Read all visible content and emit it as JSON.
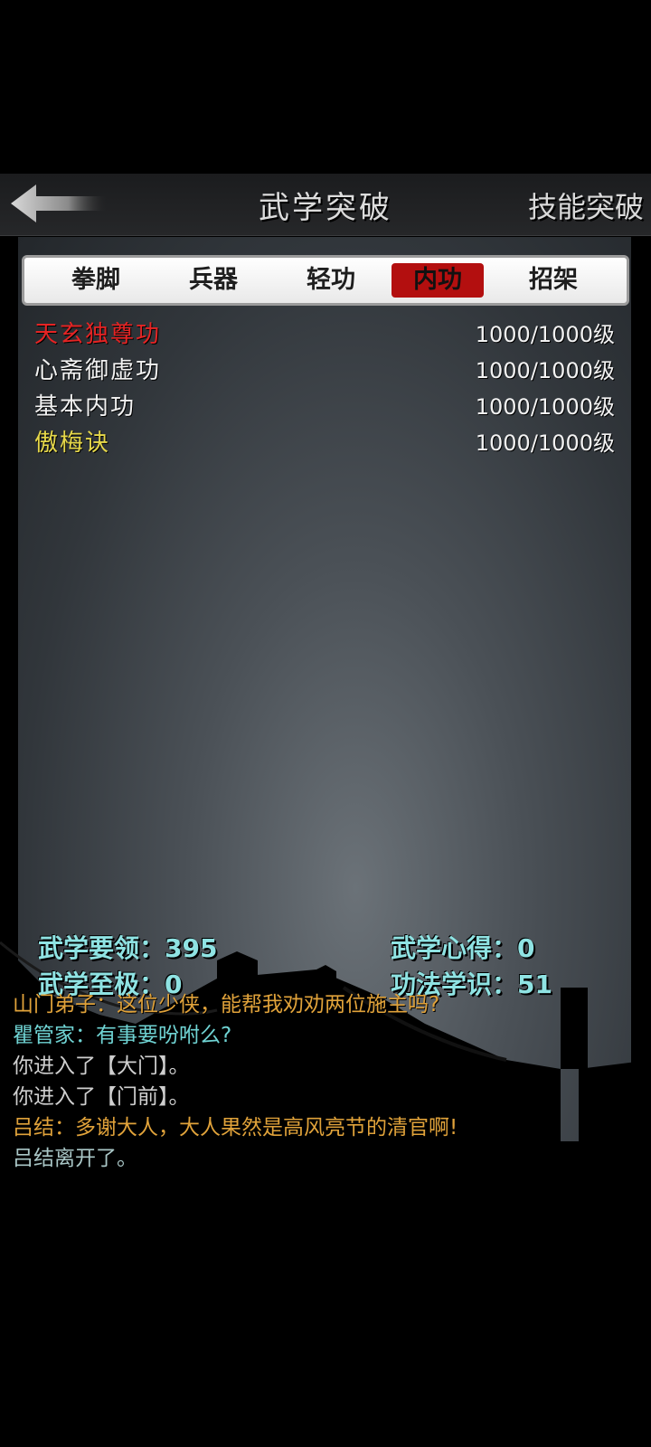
{
  "header": {
    "title": "武学突破",
    "right_button": "技能突破"
  },
  "tabs": [
    {
      "label": "拳脚",
      "active": false
    },
    {
      "label": "兵器",
      "active": false
    },
    {
      "label": "轻功",
      "active": false
    },
    {
      "label": "内功",
      "active": true
    },
    {
      "label": "招架",
      "active": false
    }
  ],
  "skills": [
    {
      "name": "天玄独尊功",
      "level": "1000/1000级",
      "color": "#e52424"
    },
    {
      "name": "心斋御虚功",
      "level": "1000/1000级",
      "color": "#f2f2f2"
    },
    {
      "name": "基本内功",
      "level": "1000/1000级",
      "color": "#f2f2f2"
    },
    {
      "name": "傲梅诀",
      "level": "1000/1000级",
      "color": "#e6d84a"
    }
  ],
  "stats": {
    "essentials": "武学要领：395",
    "insight": "武学心得：0",
    "ultimate": "武学至极：0",
    "knowledge": "功法学识：51"
  },
  "log": [
    {
      "text": "山门弟子：这位少侠，能帮我劝劝两位施主吗?",
      "color": "#e0a23a"
    },
    {
      "text": "瞿管家：有事要吩咐么?",
      "color": "#6fd3d3"
    },
    {
      "text": "你进入了【大门】。",
      "color": "#cfcfcf"
    },
    {
      "text": "你进入了【门前】。",
      "color": "#cfcfcf"
    },
    {
      "text": "吕结：多谢大人，大人果然是高风亮节的清官啊!",
      "color": "#e0a23a"
    },
    {
      "text": "吕结离开了。",
      "color": "#a9c6c6"
    }
  ],
  "colors": {
    "active_tab": "#b30f0f",
    "stat_text": "#8fe3e3"
  }
}
